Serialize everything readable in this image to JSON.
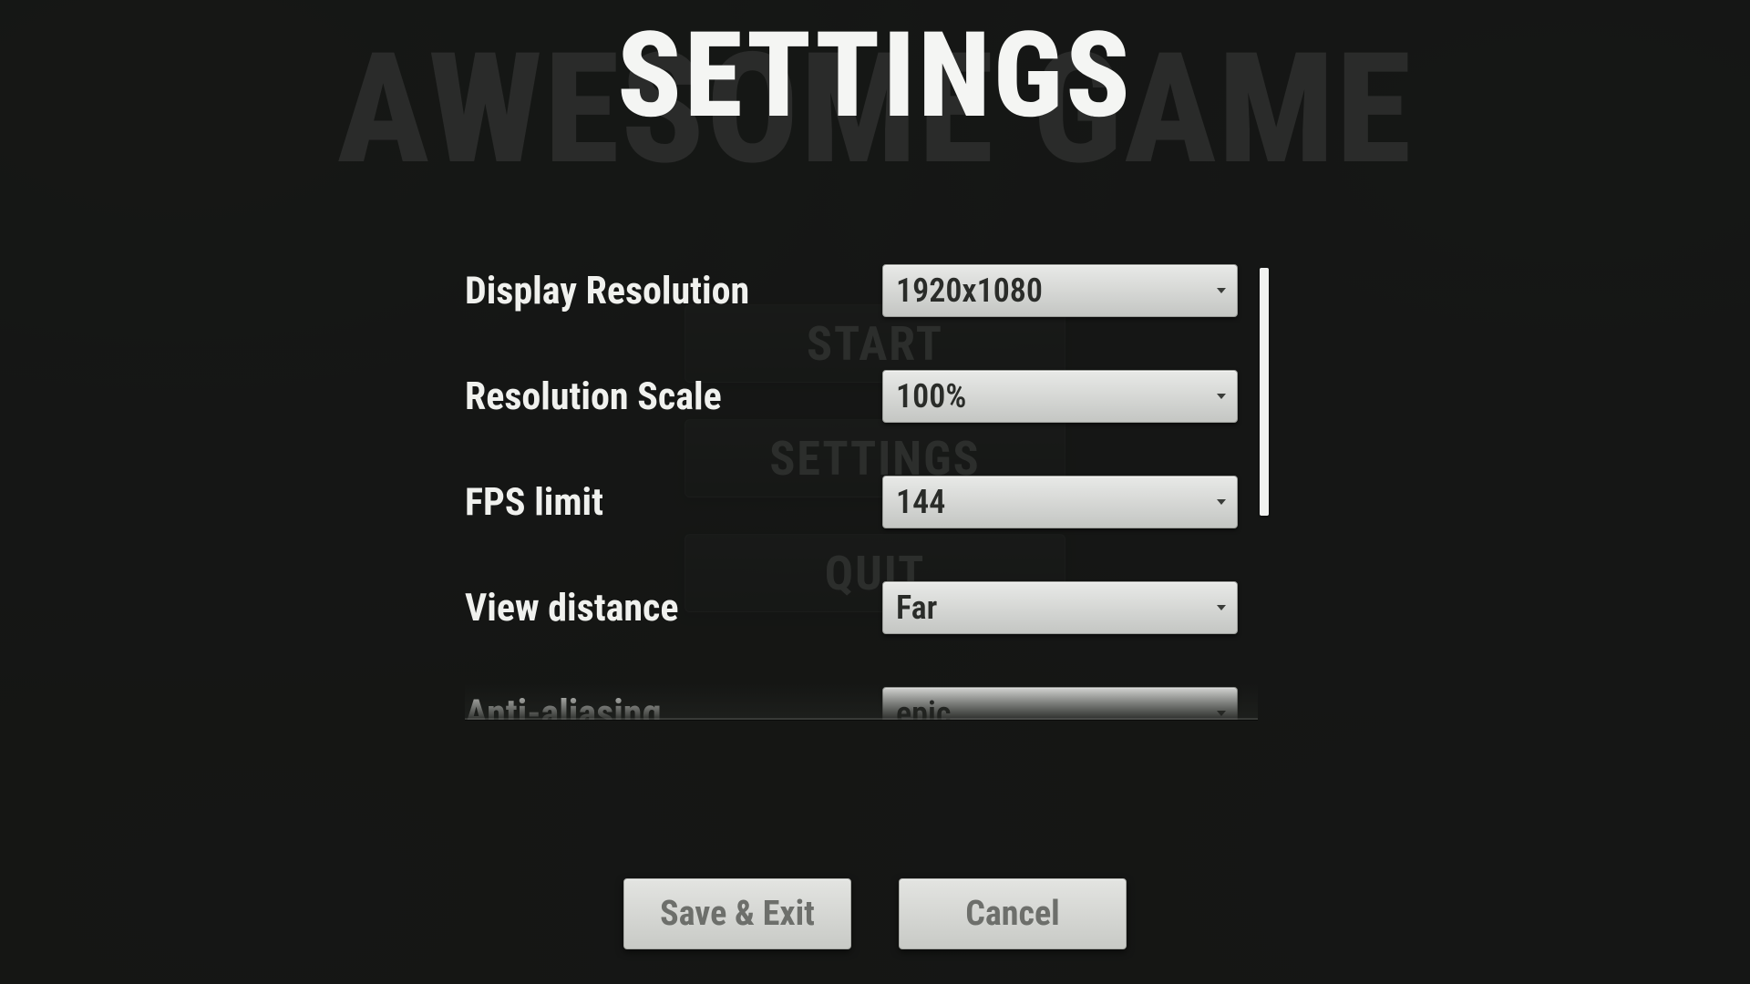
{
  "main_menu": {
    "title": "AWESOME GAME",
    "buttons": {
      "start": "START",
      "settings": "SETTINGS",
      "quit": "QUIT"
    }
  },
  "settings": {
    "title": "SETTINGS",
    "rows": [
      {
        "label": "Display Resolution",
        "value": "1920x1080"
      },
      {
        "label": "Resolution Scale",
        "value": "100%"
      },
      {
        "label": "FPS limit",
        "value": "144"
      },
      {
        "label": "View distance",
        "value": "Far"
      },
      {
        "label": "Anti-aliasing",
        "value": "epic"
      }
    ],
    "actions": {
      "save": "Save & Exit",
      "cancel": "Cancel"
    }
  }
}
